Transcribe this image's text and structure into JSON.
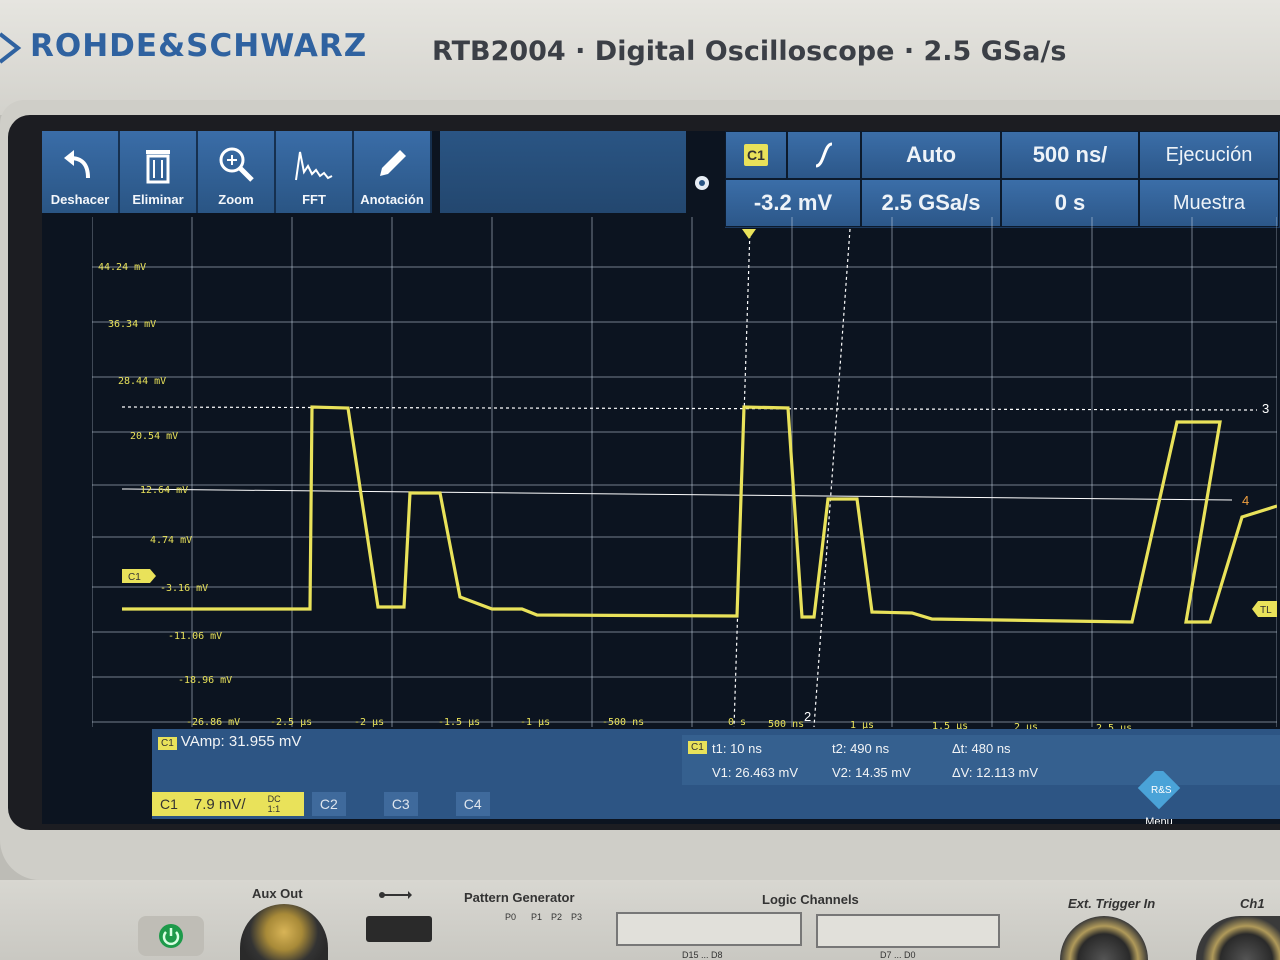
{
  "brand": "ROHDE&SCHWARZ",
  "product": "RTB2004 · Digital Oscilloscope · 2.5 GSa/s",
  "toolbar": [
    {
      "label": "Deshacer",
      "icon": "undo-icon"
    },
    {
      "label": "Eliminar",
      "icon": "trash-icon"
    },
    {
      "label": "Zoom",
      "icon": "zoom-icon"
    },
    {
      "label": "FFT",
      "icon": "fft-icon"
    },
    {
      "label": "Anotación",
      "icon": "pencil-icon"
    }
  ],
  "trigger": {
    "channel": "C1",
    "level": "-3.2 mV",
    "mode": "Auto",
    "sample_rate": "2.5 GSa/s",
    "timebase": "500 ns/",
    "position": "0 s",
    "run_state": "Ejecución",
    "acq_mode": "Muestra"
  },
  "y_axis_labels": [
    "44.24 mV",
    "36.34 mV",
    "28.44 mV",
    "20.54 mV",
    "12.64 mV",
    "4.74 mV",
    "-3.16 mV",
    "-11.06 mV",
    "-18.96 mV",
    "-26.86 mV"
  ],
  "x_axis_labels": [
    "-2.5 µs",
    "-2 µs",
    "-1.5 µs",
    "-1 µs",
    "-500 ns",
    "0 s",
    "500 ns",
    "1 µs",
    "1.5 µs",
    "2 µs",
    "2.5 µs"
  ],
  "markers": {
    "cursor3": "3",
    "cursor4": "4",
    "tl": "TL",
    "c1": "C1",
    "cursor2": "2"
  },
  "measurement": {
    "badge": "C1",
    "text": "VAmp: 31.955 mV"
  },
  "cursors": {
    "badge": "C1",
    "t1": "t1: 10 ns",
    "t2": "t2: 490 ns",
    "dt": "Δt: 480 ns",
    "v1": "V1: 26.463 mV",
    "v2": "V2: 14.35 mV",
    "dv": "ΔV: 12.113 mV"
  },
  "channels": {
    "c1_label": "C1",
    "c1_scale": "7.9 mV/",
    "c1_coupling": "DC",
    "c1_probe": "1:1",
    "c2_label": "C2",
    "c3_label": "C3",
    "c4_label": "C4",
    "menu_label": "Menu"
  },
  "front_panel": {
    "aux_out": "Aux Out",
    "pattern_generator": "Pattern Generator",
    "pattern_pins": [
      "P0",
      "P1",
      "P2",
      "P3"
    ],
    "logic_channels": "Logic Channels",
    "logic_left": "D15 ... D8",
    "logic_right": "D7 ... D0",
    "ext_trigger": "Ext. Trigger In",
    "ch1": "Ch1"
  },
  "colors": {
    "trace": "#e9e25a",
    "ui_blue": "#2d5584",
    "grid": "#c9d6e6"
  }
}
